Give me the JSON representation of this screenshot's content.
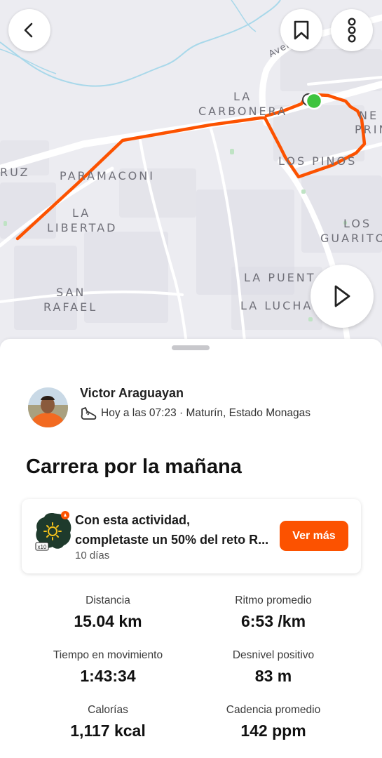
{
  "map": {
    "labels": {
      "carbonera_1": "LA",
      "carbonera_2": "CARBONERA",
      "paramaconi": "PARAMACONI",
      "ruz": "RUZ",
      "libertad_1": "LA",
      "libertad_2": "LIBERTAD",
      "los_pinos": "LOS PINOS",
      "los_guaritos_1": "LOS",
      "los_guaritos_2": "GUARITO",
      "ne_1": "NE",
      "ne_2": "PRIN",
      "san_rafael_1": "SAN",
      "san_rafael_2": "RAFAEL",
      "la_puente": "LA PUENT",
      "la_lucha": "LA LUCHA",
      "avenida": "Aven"
    },
    "route_color": "#fc5200",
    "start_marker_color": "#3fc43f"
  },
  "activity": {
    "athlete_name": "Victor Araguayan",
    "meta": "Hoy a las 07:23 · Maturín, Estado Monagas",
    "title": "Carrera por la mañana"
  },
  "challenge": {
    "line1": "Con esta actividad,",
    "line2": "completaste un 50% del reto R...",
    "days": "10 días",
    "badge_multiplier": "x10",
    "button_label": "Ver más"
  },
  "stats": [
    {
      "label": "Distancia",
      "value": "15.04 km"
    },
    {
      "label": "Ritmo promedio",
      "value": "6:53 /km"
    },
    {
      "label": "Tiempo en movimiento",
      "value": "1:43:34"
    },
    {
      "label": "Desnivel positivo",
      "value": "83 m"
    },
    {
      "label": "Calorías",
      "value": "1,117 kcal"
    },
    {
      "label": "Cadencia promedio",
      "value": "142 ppm"
    }
  ],
  "icons": {
    "back": "chevron-left-icon",
    "bookmark": "bookmark-icon",
    "more": "more-vertical-icon",
    "play": "play-icon",
    "shoe": "running-shoe-icon"
  },
  "accent_color": "#fc5200"
}
